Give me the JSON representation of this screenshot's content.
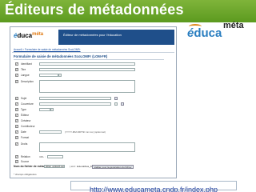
{
  "slide": {
    "title": "Éditeurs de métadonnées",
    "url": "http://www.educameta.cndp.fr/index.php"
  },
  "brand_logo": {
    "e": "é",
    "duca": "duca",
    "meta": "méta"
  },
  "app": {
    "logo_e": "é",
    "logo_duca": "duca",
    "logo_meta": "méta",
    "banner_text": "Éditeur de métadonnées pour l'éducation",
    "breadcrumb": "Accueil > Formulaire de saisie de métadonnées ScoLOMFr",
    "form_title": "Formulaire de saisie de métadonnées ScoLOMFr (LOM-FR)",
    "fields": [
      {
        "label": "Identifiant"
      },
      {
        "label": "Titre"
      },
      {
        "label": "Langue"
      },
      {
        "label": "Description"
      },
      {
        "label": "Sujet"
      },
      {
        "label": "Couverture"
      },
      {
        "label": "Type"
      },
      {
        "label": "Éditeur"
      },
      {
        "label": "Créateur"
      },
      {
        "label": "Contributeur"
      },
      {
        "label": "Date",
        "note": "(YYYY-MM-DDThh:mm:ss) (optionnel)"
      },
      {
        "label": "Format"
      },
      {
        "label": "Droits"
      },
      {
        "label": "Relation",
        "note": "URL :"
      },
      {
        "label": "Source"
      }
    ],
    "file_label": "Nom du fichier de métadonnées :",
    "file_value": "fichier_scolomfr.xml",
    "file_ext": "(.xml : EducaMeta_DublinCoreHTML)",
    "generate_button": "Valider pour la génération du fichier",
    "required_note": "* champs obligatoires"
  },
  "colors": {
    "title_bar": "#6aa62a",
    "banner": "#1f4f8a",
    "logo_blue": "#2a7ec0",
    "logo_orange": "#e08a1e"
  }
}
